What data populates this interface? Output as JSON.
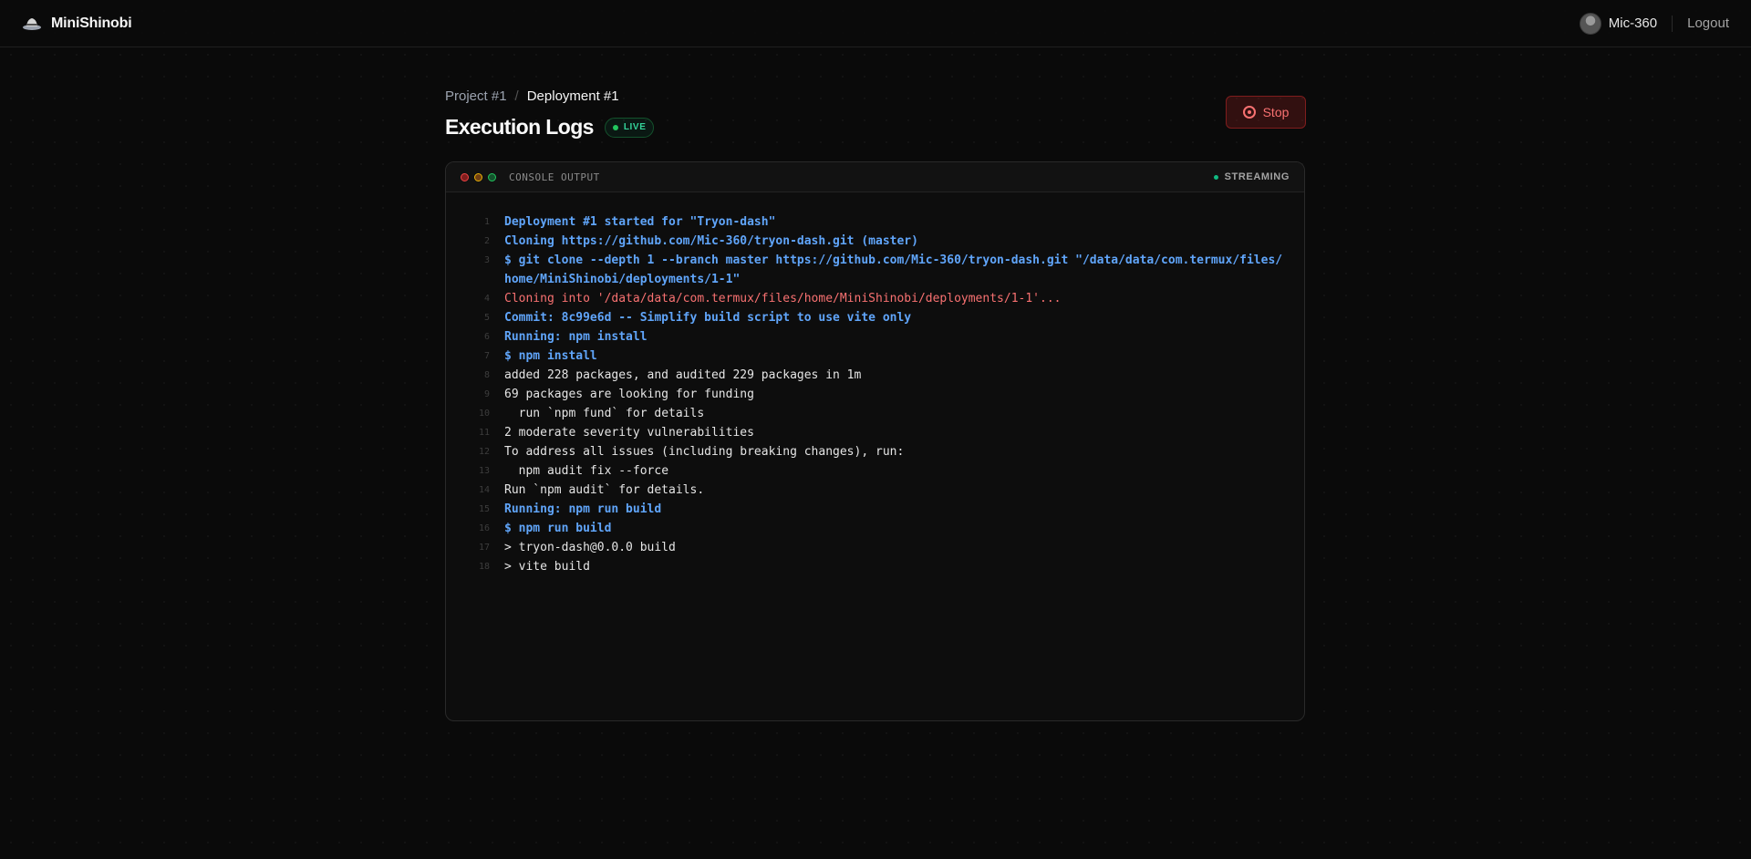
{
  "app": {
    "name": "MiniShinobi"
  },
  "user": {
    "name": "Mic-360",
    "logout_label": "Logout"
  },
  "breadcrumb": {
    "parent": "Project #1",
    "separator": "/",
    "current": "Deployment #1"
  },
  "page": {
    "title": "Execution Logs",
    "live_badge": "LIVE",
    "stop_label": "Stop"
  },
  "console": {
    "title": "CONSOLE OUTPUT",
    "status": "STREAMING",
    "lines": [
      {
        "n": "1",
        "text": "Deployment #1 started for \"Tryon-dash\"",
        "kind": "info"
      },
      {
        "n": "2",
        "text": "Cloning https://github.com/Mic-360/tryon-dash.git (master)",
        "kind": "info"
      },
      {
        "n": "3",
        "text": "$ git clone --depth 1 --branch master https://github.com/Mic-360/tryon-dash.git \"/data/data/com.termux/files/home/MiniShinobi/deployments/1-1\"",
        "kind": "info"
      },
      {
        "n": "4",
        "text": "Cloning into '/data/data/com.termux/files/home/MiniShinobi/deployments/1-1'...",
        "kind": "err"
      },
      {
        "n": "5",
        "text": "Commit: 8c99e6d -- Simplify build script to use vite only",
        "kind": "info"
      },
      {
        "n": "6",
        "text": "Running: npm install",
        "kind": "info"
      },
      {
        "n": "7",
        "text": "$ npm install",
        "kind": "info"
      },
      {
        "n": "8",
        "text": "added 228 packages, and audited 229 packages in 1m",
        "kind": "plain"
      },
      {
        "n": "9",
        "text": "69 packages are looking for funding",
        "kind": "plain"
      },
      {
        "n": "10",
        "text": "  run `npm fund` for details",
        "kind": "plain"
      },
      {
        "n": "11",
        "text": "2 moderate severity vulnerabilities",
        "kind": "plain"
      },
      {
        "n": "12",
        "text": "To address all issues (including breaking changes), run:",
        "kind": "plain"
      },
      {
        "n": "13",
        "text": "  npm audit fix --force",
        "kind": "plain"
      },
      {
        "n": "14",
        "text": "Run `npm audit` for details.",
        "kind": "plain"
      },
      {
        "n": "15",
        "text": "Running: npm run build",
        "kind": "info"
      },
      {
        "n": "16",
        "text": "$ npm run build",
        "kind": "info"
      },
      {
        "n": "17",
        "text": "> tryon-dash@0.0.0 build",
        "kind": "plain"
      },
      {
        "n": "18",
        "text": "> vite build",
        "kind": "plain"
      }
    ]
  },
  "colors": {
    "info": "#60a5fa",
    "error": "#f87171",
    "live": "#22c55e",
    "stop": "#f87171"
  },
  "icons": {
    "brand": "ninja-hat-icon",
    "stop": "stop-circle-icon"
  }
}
